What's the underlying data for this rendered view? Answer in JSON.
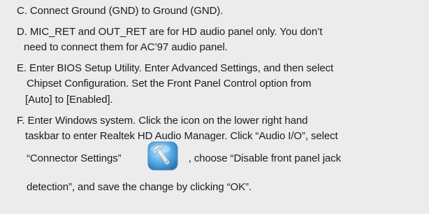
{
  "content": {
    "line1": "C. Connect Ground (GND) to Ground (GND).",
    "line2": "D. MIC_RET and OUT_RET are for HD audio panel only. You don’t",
    "line3": "need to connect them for AC’97 audio panel.",
    "line4": "E. Enter BIOS Setup Utility. Enter Advanced Settings, and then select",
    "line5": "Chipset Configuration. Set the Front Panel Control option from",
    "line6": "[Auto] to [Enabled].",
    "line7": "F. Enter Windows system. Click the icon on the lower right hand",
    "line8": "taskbar to enter Realtek HD Audio Manager. Click “Audio I/O”, select",
    "line9a": "“Connector Settings”",
    "line9b": ", choose “Disable front panel jack",
    "line10": "detection”, and save the change by clicking “OK”."
  },
  "icons": {
    "connector_settings": "wrench-settings-icon"
  },
  "colors": {
    "background": "#ececec",
    "text": "#1c1c1c",
    "icon_blue": "#4a9fdc"
  }
}
